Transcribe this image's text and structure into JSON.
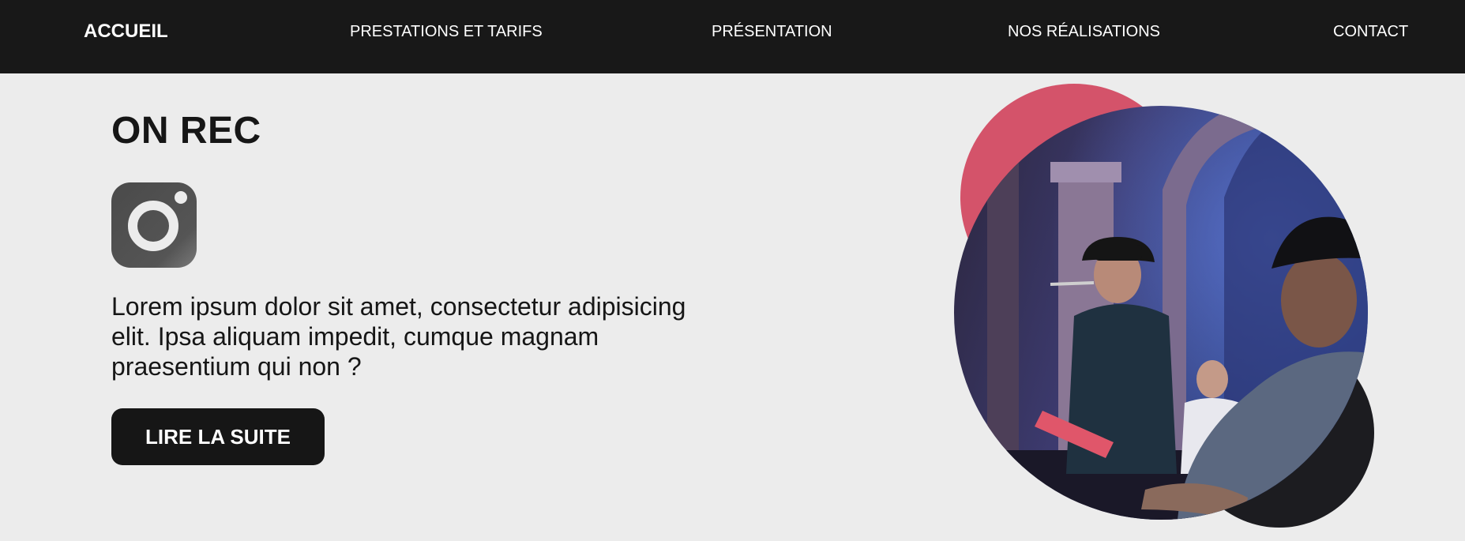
{
  "nav": {
    "home": "ACCUEIL",
    "services": "PRESTATIONS ET TARIFS",
    "presentation": "PRÉSENTATION",
    "projects": "NOS RÉALISATIONS",
    "contact": "CONTACT"
  },
  "hero": {
    "title": "ON REC",
    "social_icon": "instagram-icon",
    "text": "Lorem ipsum dolor sit amet, consectetur adipisicing elit. Ipsa aliquam impedit, cumque magnam praesentium qui non ?",
    "cta_label": "LIRE LA SUITE"
  },
  "image": {
    "subject": "concert-photo"
  },
  "colors": {
    "navbar_bg": "#181818",
    "page_bg": "#ececec",
    "accent_blob": "#d4536a",
    "dark_blob": "#1c1c20",
    "button_bg": "#161616",
    "icon_gray": "#555555"
  }
}
